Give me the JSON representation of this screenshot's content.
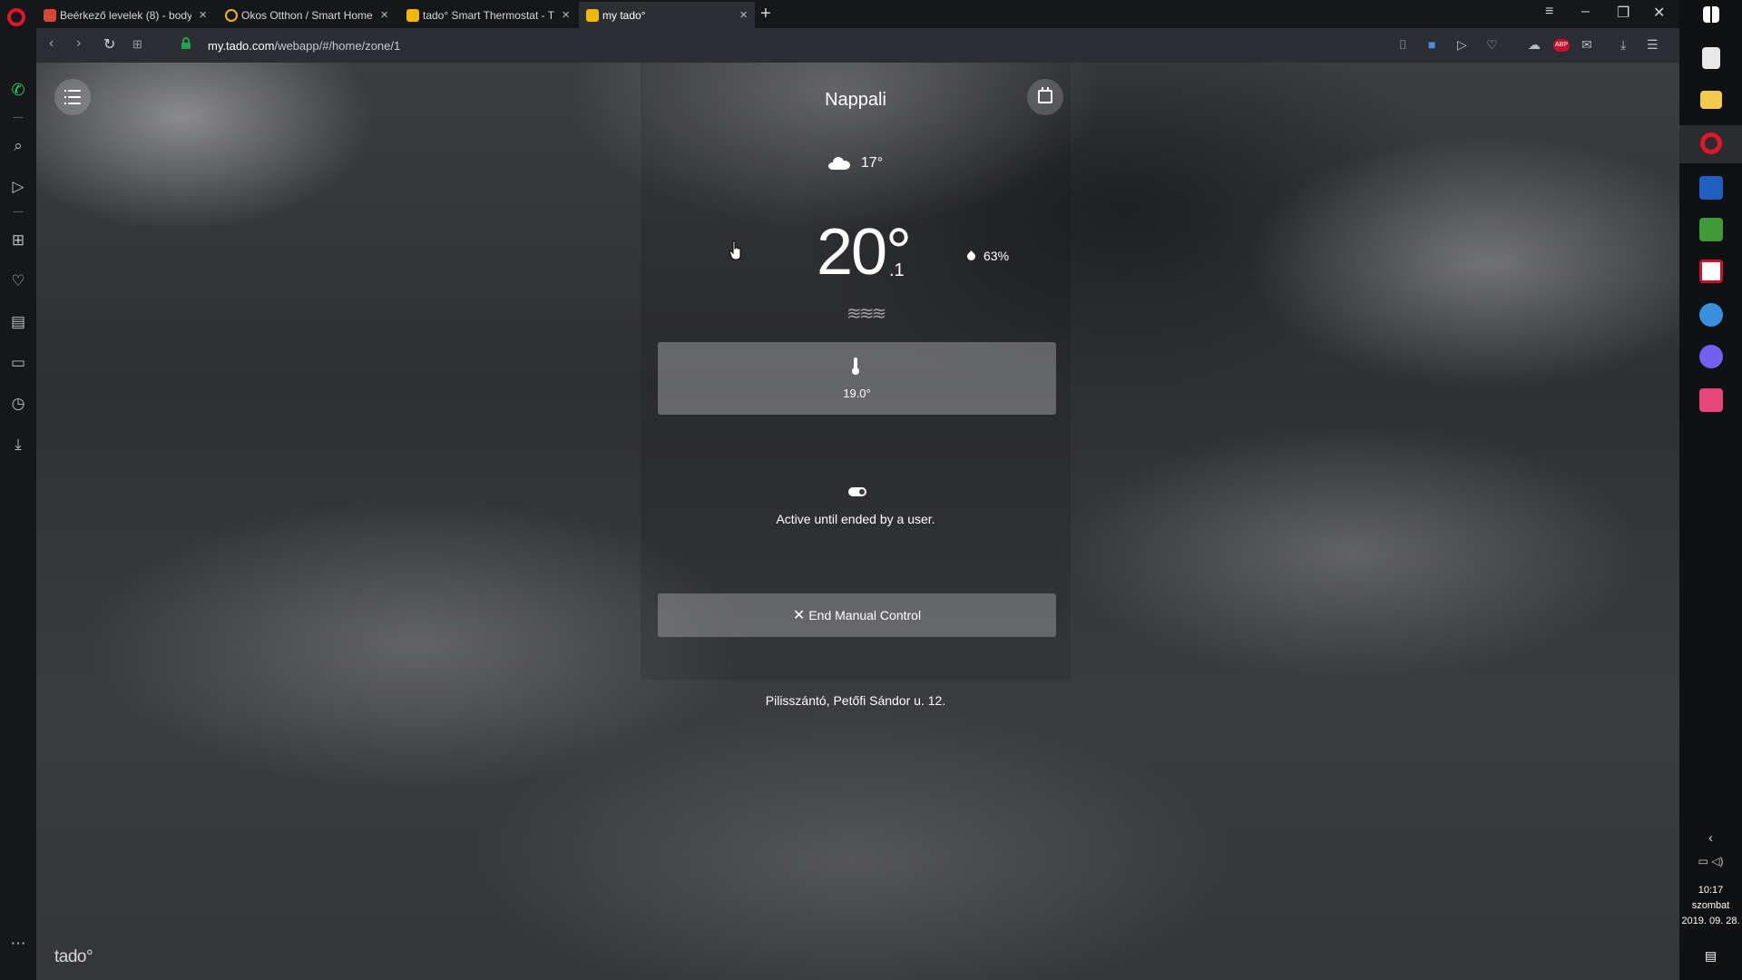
{
  "browser": {
    "tabs": [
      {
        "title": "Beérkező levelek (8) - body",
        "color": "#d14836",
        "active": false
      },
      {
        "title": "Okos Otthon / Smart Home",
        "color": "#f2b705",
        "active": false
      },
      {
        "title": "tado° Smart Thermostat - T",
        "color": "#f2b705",
        "active": false
      },
      {
        "title": "my tado°",
        "color": "#f2b705",
        "active": true
      }
    ],
    "new_tab": "+",
    "url_domain": "my.tado.com",
    "url_path": "/webapp/#/home/zone/1",
    "ext_badge": "ABP"
  },
  "app": {
    "zone_name": "Nappali",
    "outside_temp": "17°",
    "inside_temp": "20°",
    "inside_decimal": ".1",
    "humidity": "63%",
    "heating_glyph": "≋≋≋",
    "setpoint": "19.0°",
    "mode_text": "Active until ended by a user.",
    "end_button_icon": "✕",
    "end_button": "End Manual Control",
    "address": "Pilisszántó, Petőfi Sándor u. 12.",
    "logo": "tado°"
  },
  "taskbar": {
    "time": "10:17",
    "day": "szombat",
    "date": "2019. 09. 28."
  }
}
